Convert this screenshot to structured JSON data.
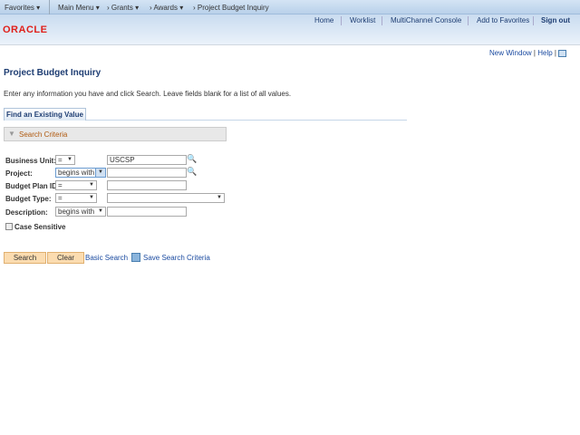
{
  "nav": {
    "favorites": "Favorites",
    "main_menu": "Main Menu",
    "crumbs": [
      "Grants",
      "Awards",
      "Project Budget Inquiry"
    ]
  },
  "header": {
    "links": [
      "Home",
      "Worklist",
      "MultiChannel Console",
      "Add to Favorites"
    ],
    "signout": "Sign out",
    "logo": "ORACLE"
  },
  "util": {
    "new_window": "New Window",
    "help": "Help"
  },
  "page": {
    "title": "Project Budget Inquiry",
    "instructions": "Enter any information you have and click Search. Leave fields blank for a list of all values.",
    "tab": "Find an Existing Value",
    "section": "Search Criteria"
  },
  "fields": [
    {
      "label": "Business Unit:",
      "op": "=",
      "value": ""
    },
    {
      "label": "Project:",
      "op": "begins with",
      "value": ""
    },
    {
      "label": "Budget Plan ID:",
      "op": "=",
      "value": ""
    },
    {
      "label": "Budget Type:",
      "op": "=",
      "value": ""
    },
    {
      "label": "Description:",
      "op": "begins with",
      "value": ""
    }
  ],
  "business_unit_value": "USCSP",
  "case_sensitive": "Case Sensitive",
  "buttons": {
    "search": "Search",
    "clear": "Clear",
    "basic": "Basic Search",
    "save": "Save Search Criteria"
  }
}
